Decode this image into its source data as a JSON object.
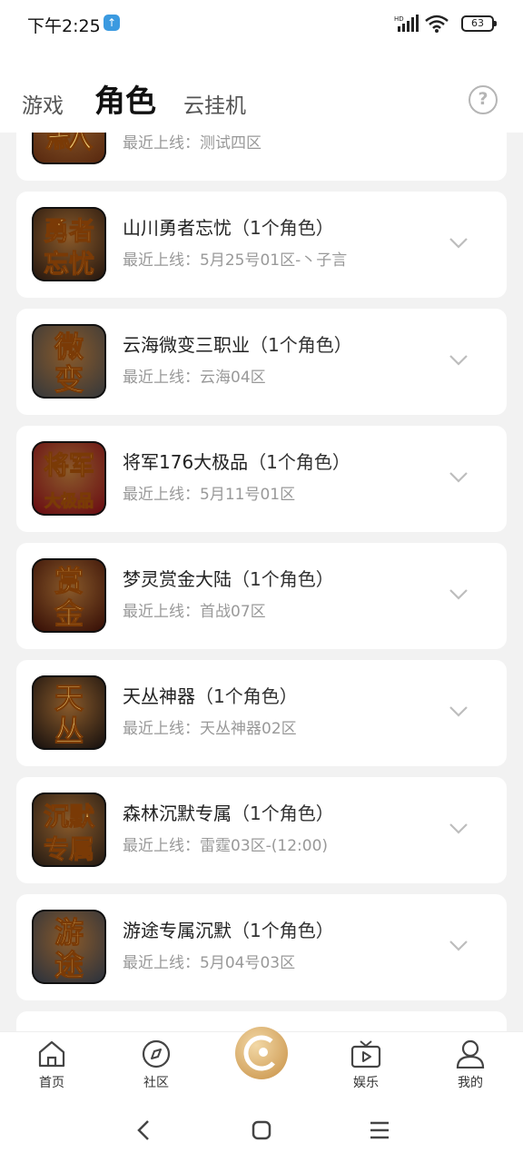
{
  "status_bar": {
    "time": "下午2:25",
    "battery": "63"
  },
  "header": {
    "tabs": [
      {
        "label": "游戏"
      },
      {
        "label": "角色"
      },
      {
        "label": "云挂机"
      }
    ],
    "help_icon": "?"
  },
  "list": {
    "items": [
      {
        "title": "",
        "count": "",
        "last_online": "最近上线：测试四区",
        "icon_text": [
          "默"
        ],
        "icon_color": "#5a2a10"
      },
      {
        "title": "山川勇者忘忧",
        "count": "（1个角色）",
        "last_online": "最近上线：5月25号01区-丶子言",
        "icon_text": [
          "勇者",
          "忘忧"
        ],
        "icon_color": "#2a1a10"
      },
      {
        "title": "云海微变三职业",
        "count": "（1个角色）",
        "last_online": "最近上线：云海04区",
        "icon_text": [
          "微",
          "变"
        ],
        "icon_color": "#3a3a3a"
      },
      {
        "title": "将军176大极品",
        "count": "（1个角色）",
        "last_online": "最近上线：5月11号01区",
        "icon_text": [
          "将军",
          "大极品"
        ],
        "icon_color": "#6b0f14"
      },
      {
        "title": "梦灵赏金大陆",
        "count": "（1个角色）",
        "last_online": "最近上线：首战07区",
        "icon_text": [
          "赏",
          "金"
        ],
        "icon_color": "#3a1208"
      },
      {
        "title": "天丛神器",
        "count": "（1个角色）",
        "last_online": "最近上线：天丛神器02区",
        "icon_text": [
          "天",
          "丛"
        ],
        "icon_color": "#1c1410"
      },
      {
        "title": "森林沉默专属",
        "count": "（1个角色）",
        "last_online": "最近上线：雷霆03区-(12:00)",
        "icon_text": [
          "沉默",
          "专属"
        ],
        "icon_color": "#2a1e14"
      },
      {
        "title": "游途专属沉默",
        "count": "（1个角色）",
        "last_online": "最近上线：5月04号03区",
        "icon_text": [
          "游",
          "途"
        ],
        "icon_color": "#30343c"
      }
    ]
  },
  "bottom_nav": {
    "items": [
      {
        "label": "首页",
        "icon": "home-icon"
      },
      {
        "label": "社区",
        "icon": "compass-icon"
      },
      {
        "label": "",
        "icon": "center-logo-icon"
      },
      {
        "label": "娱乐",
        "icon": "tv-icon"
      },
      {
        "label": "我的",
        "icon": "user-icon"
      }
    ]
  }
}
